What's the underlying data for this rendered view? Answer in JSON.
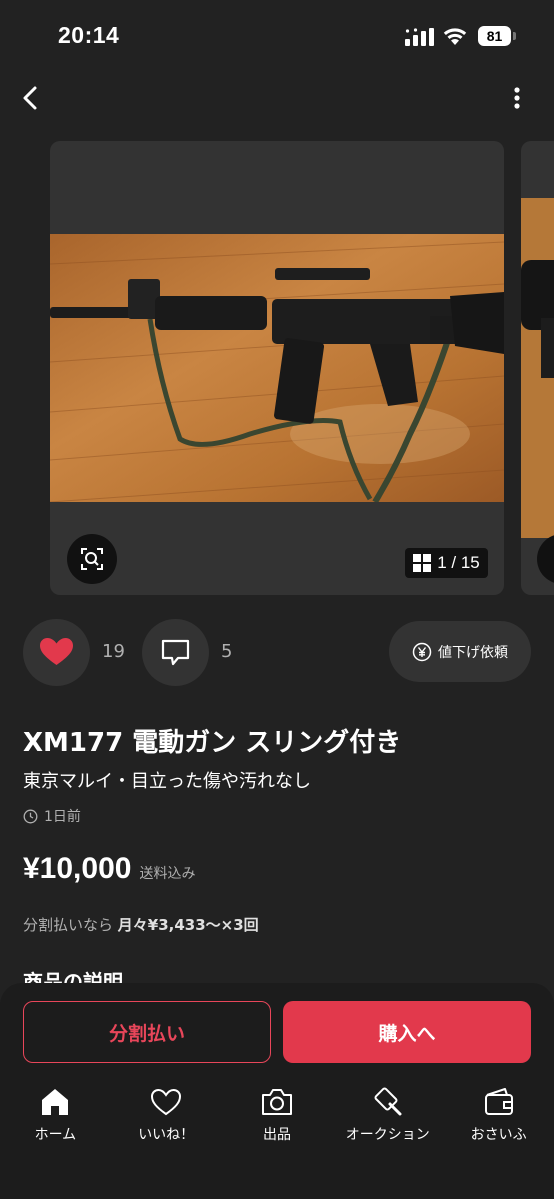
{
  "status_bar": {
    "time": "20:14",
    "battery": "81"
  },
  "carousel": {
    "counter": "1 / 15"
  },
  "actions": {
    "like_count": "19",
    "comment_count": "5",
    "price_down_label": "値下げ依頼"
  },
  "item": {
    "title": "XM177 電動ガン スリング付き",
    "subtitle": "東京マルイ・目立った傷や汚れなし",
    "posted": "1日前",
    "price": "¥10,000",
    "shipping": "送料込み",
    "installment_prefix": "分割払いなら",
    "installment_amount": "月々¥3,433～×3回",
    "section_heading": "商品の説明"
  },
  "buttons": {
    "installment": "分割払い",
    "buy": "購入へ"
  },
  "tabs": [
    {
      "label": "ホーム",
      "icon": "home-icon"
    },
    {
      "label": "いいね！",
      "icon": "heart-outline-icon"
    },
    {
      "label": "出品",
      "icon": "camera-icon"
    },
    {
      "label": "オークション",
      "icon": "gavel-icon"
    },
    {
      "label": "おさいふ",
      "icon": "wallet-icon"
    }
  ],
  "colors": {
    "accent": "#e2394c",
    "background": "#222222",
    "card": "#333333"
  }
}
